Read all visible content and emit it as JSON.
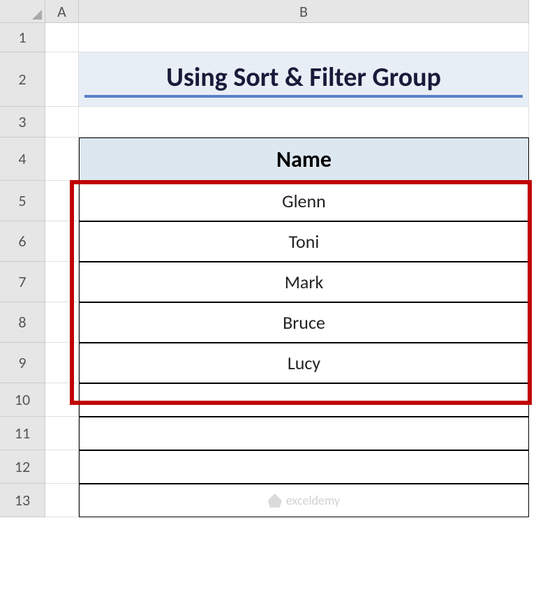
{
  "columns": {
    "A": "A",
    "B": "B"
  },
  "rows": [
    "1",
    "2",
    "3",
    "4",
    "5",
    "6",
    "7",
    "8",
    "9",
    "10",
    "11",
    "12",
    "13"
  ],
  "title": "Using Sort & Filter Group",
  "table": {
    "header": "Name",
    "data": [
      "Glenn",
      "Toni",
      "Mark",
      "Bruce",
      "Lucy"
    ]
  },
  "watermark": "exceldemy"
}
